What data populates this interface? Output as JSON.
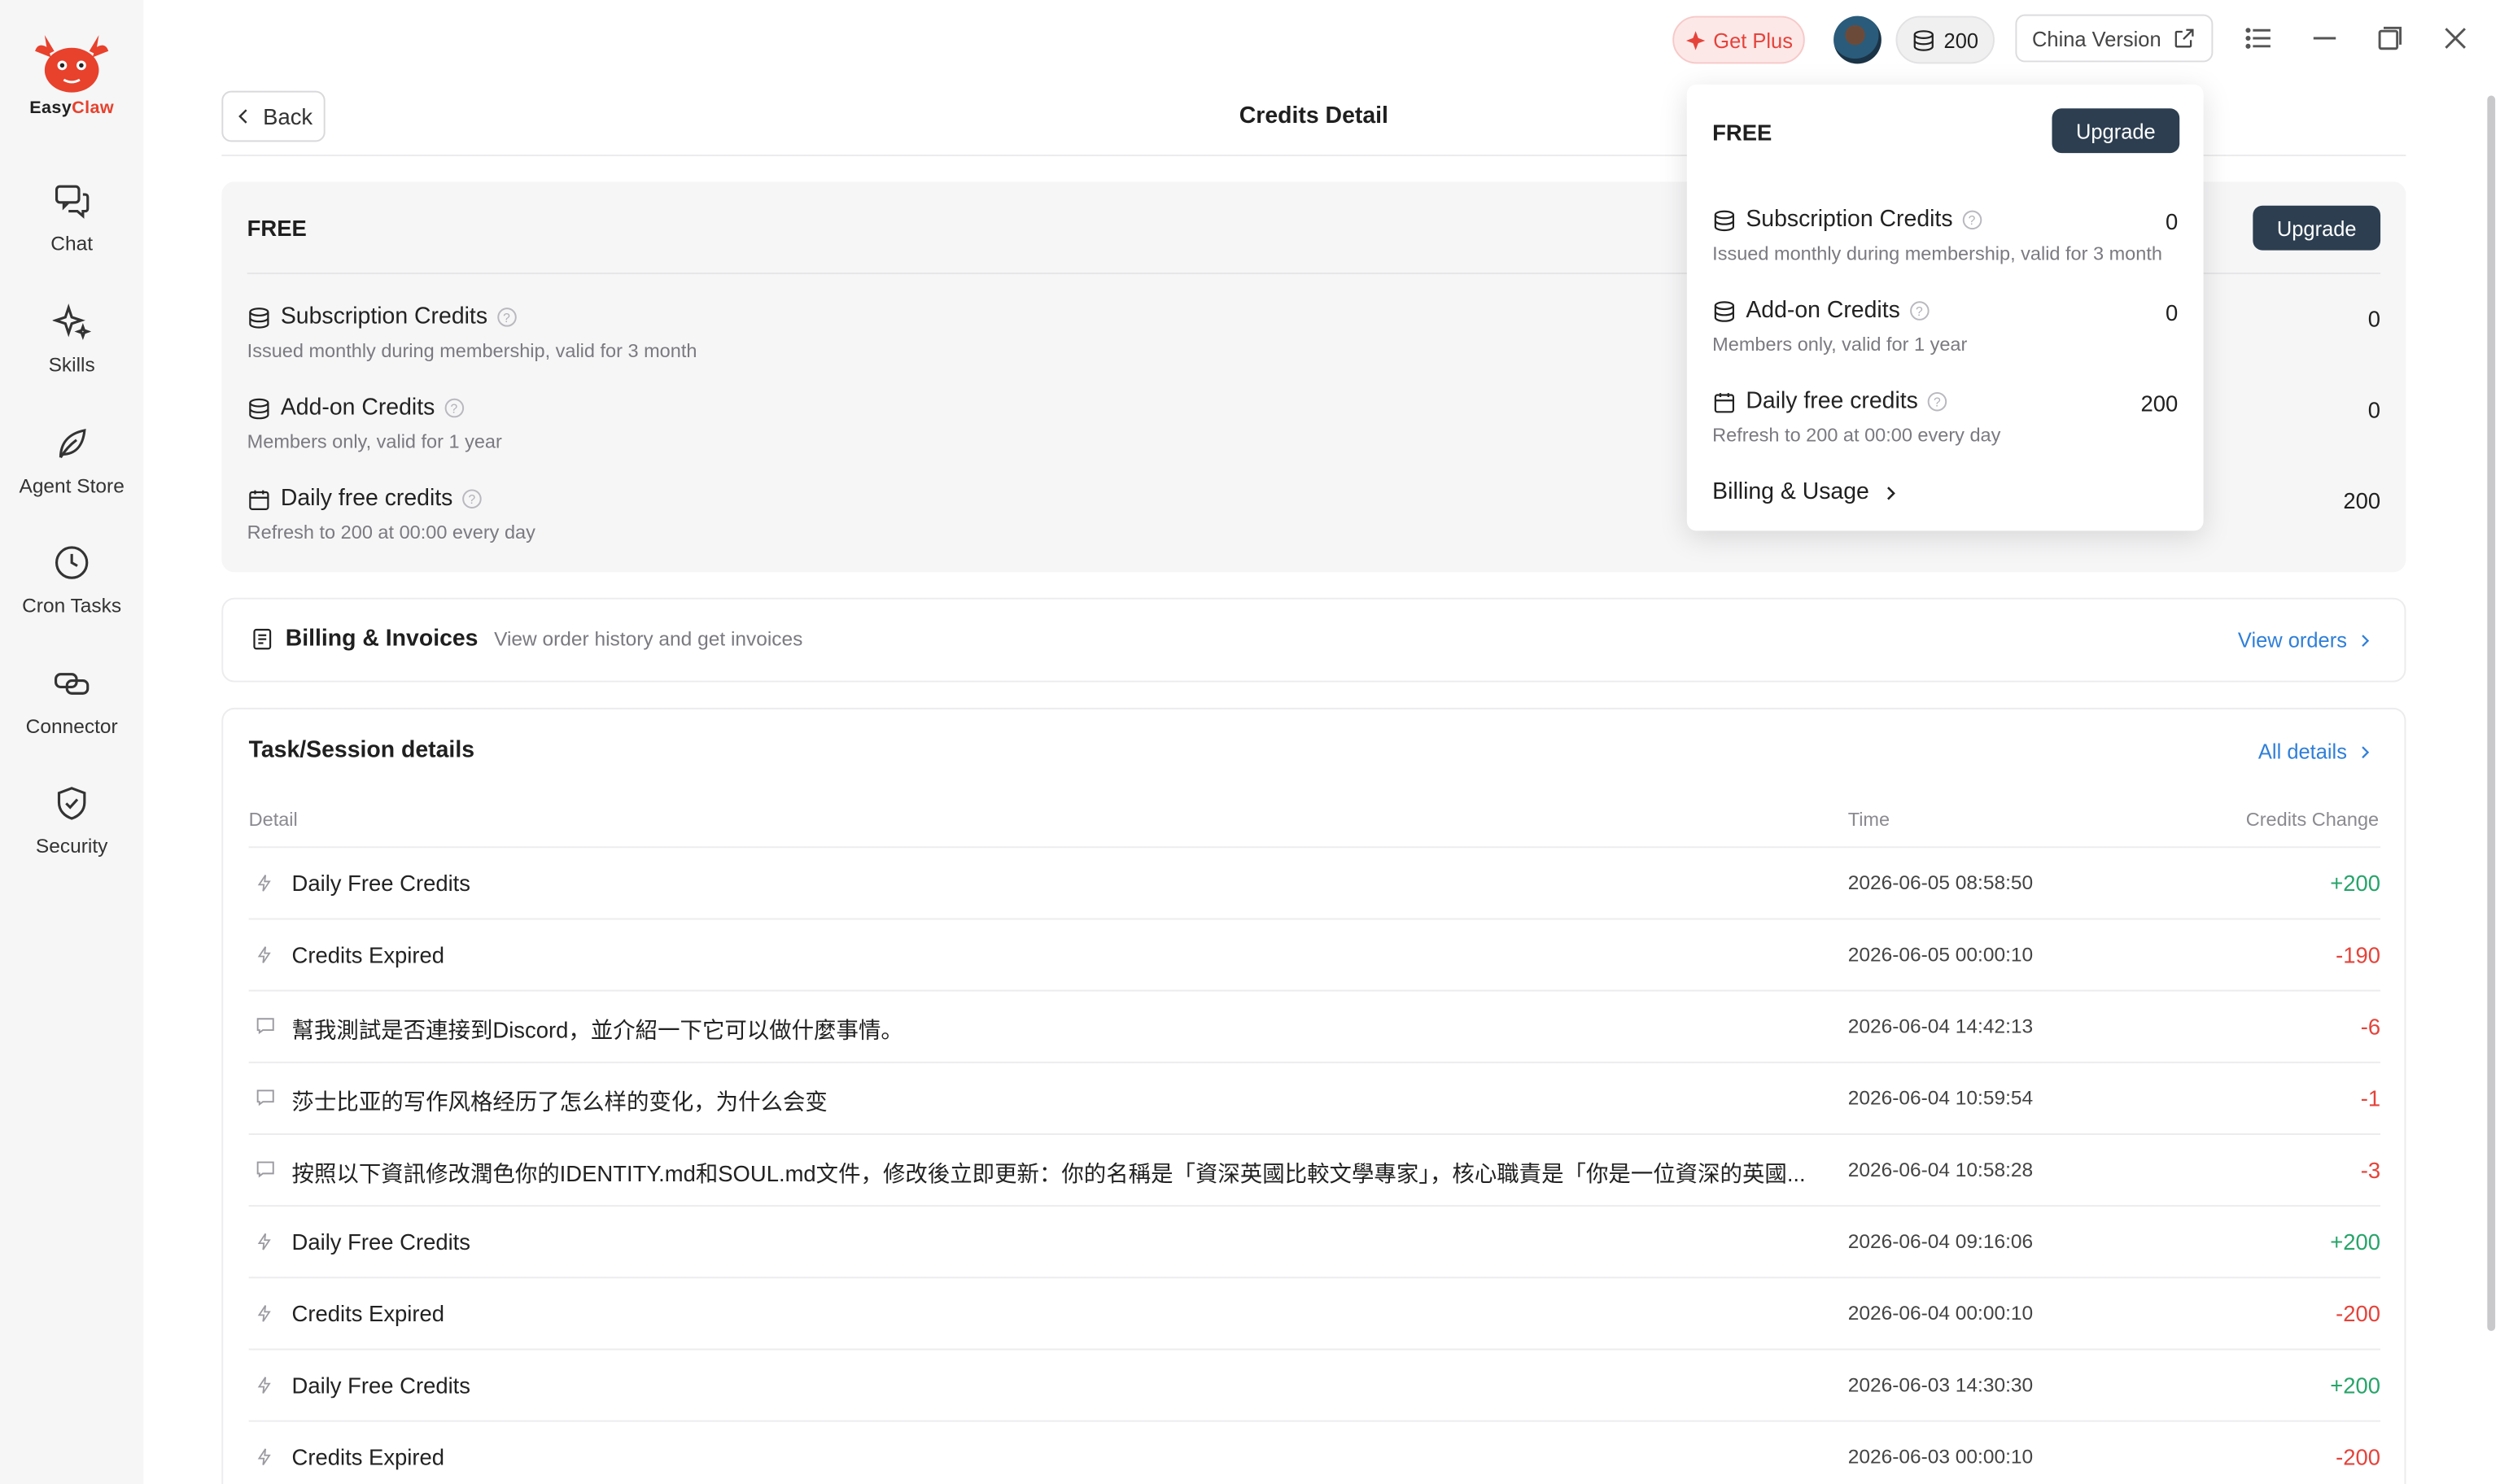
{
  "app": {
    "name_part1": "Easy",
    "name_part2": "Claw",
    "brand_color": "#e8412c"
  },
  "sidebar": {
    "items": [
      {
        "label": "Chat",
        "icon": "chat-icon"
      },
      {
        "label": "Skills",
        "icon": "sparkle-icon"
      },
      {
        "label": "Agent Store",
        "icon": "leaf-icon"
      },
      {
        "label": "Cron Tasks",
        "icon": "clock-icon"
      },
      {
        "label": "Connector",
        "icon": "link-icon"
      },
      {
        "label": "Security",
        "icon": "shield-icon"
      }
    ]
  },
  "topbar": {
    "get_plus": "Get Plus",
    "credits": "200",
    "china_version": "China Version"
  },
  "header": {
    "back": "Back",
    "title": "Credits Detail"
  },
  "plan": {
    "tier": "FREE",
    "upgrade": "Upgrade",
    "subscription": {
      "label": "Subscription Credits",
      "desc": "Issued monthly during membership, valid for 3 month",
      "value": "0"
    },
    "addon": {
      "label": "Add-on Credits",
      "desc": "Members only, valid for 1 year",
      "value": "0"
    },
    "daily": {
      "label": "Daily free credits",
      "desc": "Refresh to 200 at 00:00 every day",
      "value": "200"
    }
  },
  "billing": {
    "title": "Billing & Invoices",
    "desc": "View order history and get invoices",
    "link": "View orders"
  },
  "tasks": {
    "title": "Task/Session details",
    "link": "All details",
    "columns": {
      "detail": "Detail",
      "time": "Time",
      "change": "Credits Change"
    },
    "rows": [
      {
        "icon": "bolt",
        "detail": "Daily Free Credits",
        "time": "2026-06-05 08:58:50",
        "change": "+200",
        "sign": "pos"
      },
      {
        "icon": "bolt",
        "detail": "Credits Expired",
        "time": "2026-06-05 00:00:10",
        "change": "-190",
        "sign": "neg"
      },
      {
        "icon": "msg",
        "detail": "幫我測試是否連接到Discord，並介紹一下它可以做什麼事情。",
        "time": "2026-06-04 14:42:13",
        "change": "-6",
        "sign": "neg"
      },
      {
        "icon": "msg",
        "detail": "莎士比亚的写作风格经历了怎么样的变化，为什么会变",
        "time": "2026-06-04 10:59:54",
        "change": "-1",
        "sign": "neg"
      },
      {
        "icon": "msg",
        "detail": "按照以下資訊修改潤色你的IDENTITY.md和SOUL.md文件，修改後立即更新：你的名稱是「資深英國比較文學專家」，核心職責是「你是一位資深的英國...",
        "time": "2026-06-04 10:58:28",
        "change": "-3",
        "sign": "neg"
      },
      {
        "icon": "bolt",
        "detail": "Daily Free Credits",
        "time": "2026-06-04 09:16:06",
        "change": "+200",
        "sign": "pos"
      },
      {
        "icon": "bolt",
        "detail": "Credits Expired",
        "time": "2026-06-04 00:00:10",
        "change": "-200",
        "sign": "neg"
      },
      {
        "icon": "bolt",
        "detail": "Daily Free Credits",
        "time": "2026-06-03 14:30:30",
        "change": "+200",
        "sign": "pos"
      },
      {
        "icon": "bolt",
        "detail": "Credits Expired",
        "time": "2026-06-03 00:00:10",
        "change": "-200",
        "sign": "neg"
      }
    ]
  },
  "popup": {
    "tier": "FREE",
    "upgrade": "Upgrade",
    "subscription": {
      "label": "Subscription Credits",
      "desc": "Issued monthly during membership, valid for 3 month",
      "value": "0"
    },
    "addon": {
      "label": "Add-on Credits",
      "desc": "Members only, valid for 1 year",
      "value": "0"
    },
    "daily": {
      "label": "Daily free credits",
      "desc": "Refresh to 200 at 00:00 every day",
      "value": "200"
    },
    "billing_link": "Billing & Usage"
  }
}
